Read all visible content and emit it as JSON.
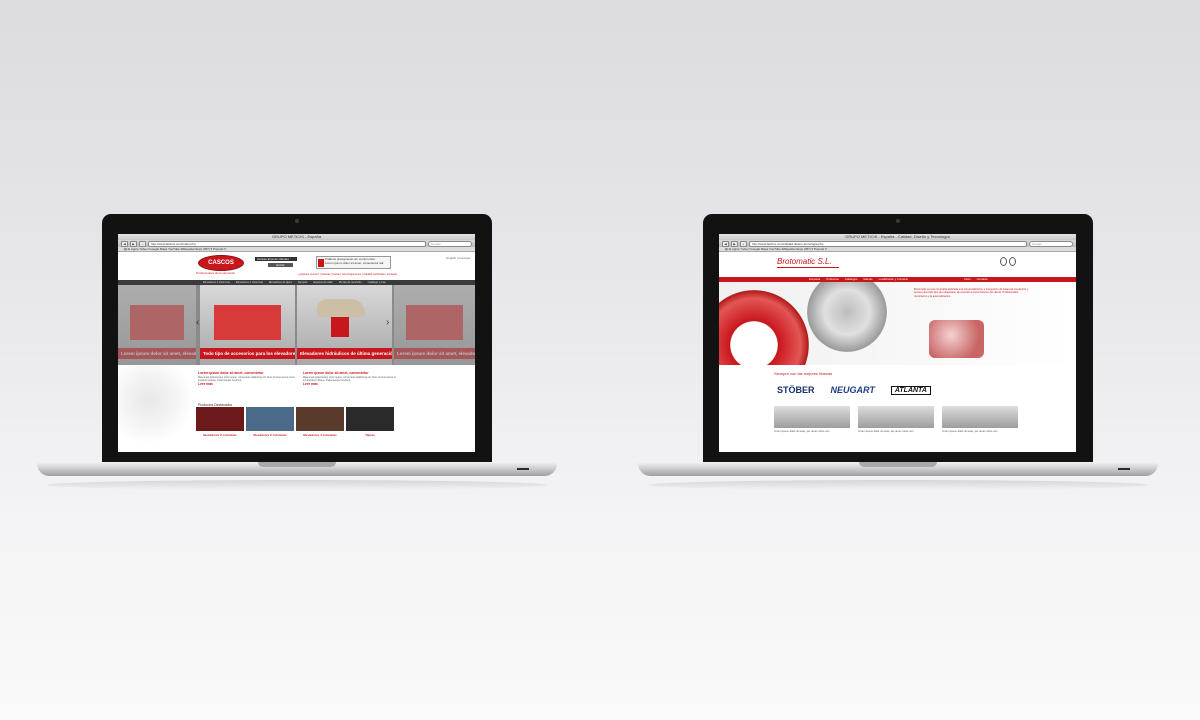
{
  "left_laptop": {
    "browser": {
      "title": "GRUPO METICIS - España",
      "url": "http://www.fastrics.com/index.php",
      "search_placeholder": "Google",
      "bookmarks": "▤  ⊞  Apple  Yahoo!  Google Maps  YouTube  Wikipedia  News (357) ▾  Popular ▾"
    },
    "site": {
      "logo": "CASCOS",
      "tagline": "Profesionales de la elevación",
      "access_label": "Acceso área de clientes",
      "access_button": "Entrar",
      "promo_text": "Pídanos presupuesto sin compromiso",
      "promo_sub": "Lorem ipsum dolor sit amet, consectetur adi.",
      "header_links": "English | Francais",
      "top_nav": "¿Quiénes somos?  |  Noticias  |  Ferias  |  Homologaciones  |  Calidad certificada  |  Contacto",
      "main_nav": [
        "Elevadores 2 columnas",
        "Elevadores 4 columnas",
        "Elevadores de tijera",
        "Rampas",
        "Equipos de taller",
        "Piezas de recambio",
        "Catálogo y más"
      ],
      "slides": [
        {
          "caption": "Lorem ipsum dolor sit amet, elevadores"
        },
        {
          "caption": "Todo tipo de accesorios para los elevadores."
        },
        {
          "caption": "Elevadores hidráulicos de última generación."
        },
        {
          "caption": "Lorem ipsum dolor sit amet, elevadores"
        }
      ],
      "articles": [
        {
          "title": "Lorem ipsum dolor sit amet, consectetur",
          "text": "Maecenas pellentesque tortor neque, consectetur adipiscing elit. Nunc sit amet purus ut leo tincidunt tristique. Pellentesque hendrerit.",
          "more": "Leer más"
        },
        {
          "title": "Lorem ipsum dolor sit amet, consectetur",
          "text": "Maecenas pellentesque tortor neque, consectetur adipiscing elit. Nunc sit amet purus ut leo tincidunt tristique. Pellentesque hendrerit.",
          "more": "Leer más"
        }
      ],
      "featured_title": "Productos Destacados",
      "thumbs": [
        "Elevadores 2 columnas",
        "Elevadores 2 columnas",
        "Elevadores 4 columnas",
        "Tijeras"
      ]
    }
  },
  "right_laptop": {
    "browser": {
      "title": "GRUPO METICIS - España - Calidad, Diseño y Tecnología",
      "url": "http://www.fastrics.com/calidad-diseno-tecnologia.php",
      "search_placeholder": "Google",
      "bookmarks": "▤  ⊞  Apple  Yahoo!  Google Maps  YouTube  Wikipedia  News (357) ▾  Popular ▾"
    },
    "site": {
      "logo": "Brotomatic S.L.",
      "nav": [
        "Empresa",
        "Productos",
        "Catálogos",
        "Marcas",
        "Localización y Contacto",
        "Inicio",
        "Contacto"
      ],
      "hero_text": "Brotomatic es una compañía dedicada a la comercialización e integración de sistemas mecánicos y servos para todo tipo de maquinaria, de acuerdo a transmisiones del cliente. Profesionales movimiento y la automatización.",
      "brands_title": "Siempre con las mejores Marcas",
      "brands": [
        "STÖBER",
        "NEUGART",
        "ATLANTA"
      ],
      "products": [
        "Lorem ipsum dolor sit amet, per amet corsis non",
        "Lorem ipsum dolor sit amet, per amet corsis non",
        "Lorem ipsum dolor sit amet, per amet corsis non"
      ]
    }
  },
  "colors": {
    "brand_red": "#c8161d",
    "dark_nav": "#3b3b3b",
    "brand_blue": "#1d3e86"
  }
}
